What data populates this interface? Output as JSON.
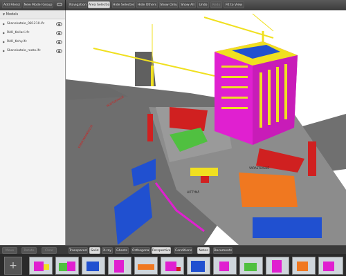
{
  "toolbar_left": {
    "add_files": "Add File(s)",
    "new_model_group": "New Model Group"
  },
  "toolbar": {
    "navigation": "Navigation",
    "area_selection": "Area Selection",
    "hide_selected": "Hide Selected",
    "hide_others": "Hide Others",
    "show_only": "Show Only",
    "show_all": "Show All",
    "undo": "Undo",
    "redo": "Redo",
    "fit_to_view": "Fit to View"
  },
  "sidebar": {
    "title": "Models",
    "items": [
      {
        "label": "Skanskatalo_081210.ifc"
      },
      {
        "label": "RAK_Kellari.ifc"
      },
      {
        "label": "RAK_Kehy.ifc"
      },
      {
        "label": "Skanskatalo_rooto.ifc"
      }
    ]
  },
  "bottom_left": {
    "b1": "Move",
    "b2": "Rotate",
    "b3": "Clear"
  },
  "bottom": {
    "transparent": "Transparent",
    "solid": "Solid",
    "xray": "X-ray",
    "ghosts": "Ghosts",
    "orthogonal": "Orthogonal",
    "perspective": "Perspective",
    "conditions": "Conditions",
    "notes": "Notes",
    "documents": "Documents"
  },
  "scene": {
    "label_site": "VARASTOALUE",
    "label_left": "KOKOONPANOALUE",
    "label_ramp": "LIITTYMÄ",
    "label_road": "NOSTURIALUE"
  },
  "colors": {
    "magenta": "#e020d0",
    "yellow": "#f0e020",
    "blue": "#2050d0",
    "orange": "#f07820",
    "green": "#50c040",
    "red": "#d02020"
  }
}
